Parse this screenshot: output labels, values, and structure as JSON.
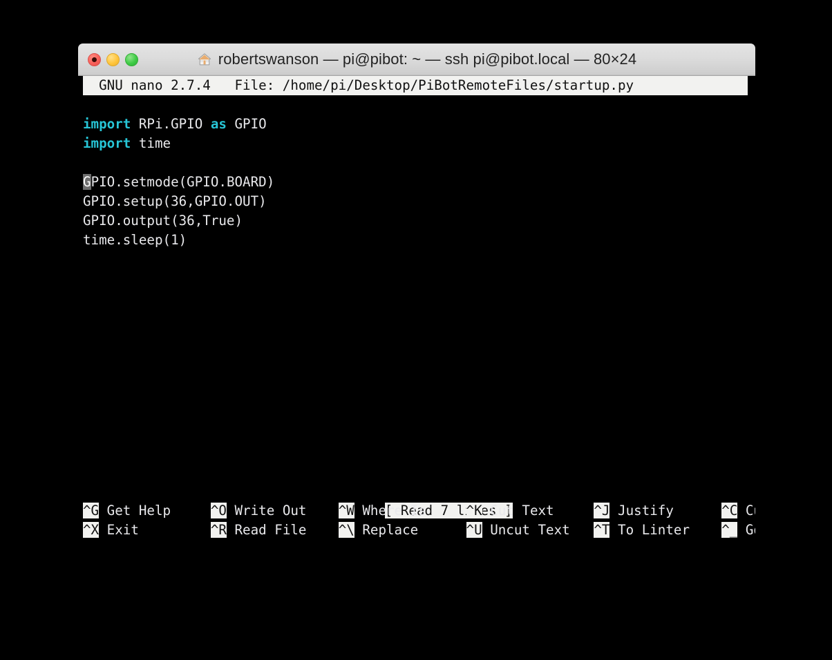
{
  "window": {
    "title": "robertswanson — pi@pibot: ~ — ssh pi@pibot.local — 80×24",
    "icon": "home-icon",
    "dimensions_label": "80×24",
    "traffic_lights": [
      {
        "name": "close-button",
        "label": "",
        "color": "#f9605a"
      },
      {
        "name": "minimize-button",
        "label": "",
        "color": "#ffc53d"
      },
      {
        "name": "zoom-button",
        "label": "",
        "color": "#3ecb45"
      }
    ]
  },
  "editor": {
    "header": "  GNU nano 2.7.4   File: /home/pi/Desktop/PiBotRemoteFiles/startup.py",
    "program": "GNU nano",
    "version": "2.7.4",
    "file_label": "File:",
    "file_path": "/home/pi/Desktop/PiBotRemoteFiles/startup.py",
    "status_message": "[ Read 7 lines ]",
    "cursor": {
      "line": 4,
      "column": 1,
      "char": "G"
    },
    "lines": [
      {
        "n": 1,
        "segments": [
          {
            "t": "import",
            "k": true
          },
          {
            "t": " RPi.GPIO ",
            "k": false
          },
          {
            "t": "as",
            "k": true
          },
          {
            "t": " GPIO",
            "k": false
          }
        ]
      },
      {
        "n": 2,
        "segments": [
          {
            "t": "import",
            "k": true
          },
          {
            "t": " time",
            "k": false
          }
        ]
      },
      {
        "n": 3,
        "segments": []
      },
      {
        "n": 4,
        "segments": [
          {
            "t": "G",
            "k": false,
            "cursor": true
          },
          {
            "t": "PIO.setmode(GPIO.BOARD)",
            "k": false
          }
        ]
      },
      {
        "n": 5,
        "segments": [
          {
            "t": "GPIO.setup(36,GPIO.OUT)",
            "k": false
          }
        ]
      },
      {
        "n": 6,
        "segments": [
          {
            "t": "GPIO.output(36,True)",
            "k": false
          }
        ]
      },
      {
        "n": 7,
        "segments": [
          {
            "t": "time.sleep(1)",
            "k": false
          }
        ]
      }
    ],
    "shortcuts": {
      "row1": [
        {
          "key": "^G",
          "label": "Get Help"
        },
        {
          "key": "^O",
          "label": "Write Out"
        },
        {
          "key": "^W",
          "label": "Where Is"
        },
        {
          "key": "^K",
          "label": "Cut Text"
        },
        {
          "key": "^J",
          "label": "Justify"
        },
        {
          "key": "^C",
          "label": "Cur Pos"
        }
      ],
      "row2": [
        {
          "key": "^X",
          "label": "Exit"
        },
        {
          "key": "^R",
          "label": "Read File"
        },
        {
          "key": "^\\",
          "label": "Replace"
        },
        {
          "key": "^U",
          "label": "Uncut Text"
        },
        {
          "key": "^T",
          "label": "To Linter"
        },
        {
          "key": "^_",
          "label": "Go To Line"
        }
      ]
    }
  },
  "colors": {
    "background": "#000000",
    "foreground": "#e9e9ec",
    "keyword": "#27c5d6",
    "reverse_bg": "#f2f2f0",
    "reverse_fg": "#111111",
    "cursor_bg": "#6e6e6e",
    "titlebar": "#dcdcdc"
  }
}
